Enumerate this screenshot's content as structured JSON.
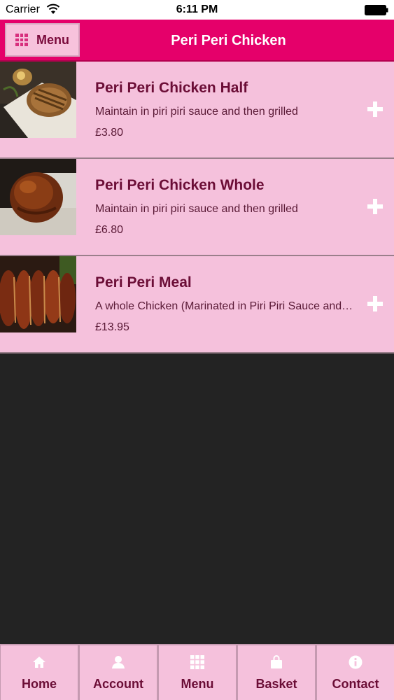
{
  "status_bar": {
    "carrier": "Carrier",
    "time": "6:11 PM"
  },
  "header": {
    "menu_button_label": "Menu",
    "title": "Peri Peri Chicken"
  },
  "items": [
    {
      "title": "Peri Peri Chicken Half",
      "description": "Maintain in piri piri sauce and then grilled",
      "price": "£3.80"
    },
    {
      "title": "Peri Peri Chicken Whole",
      "description": "Maintain in piri piri sauce and then grilled",
      "price": "£6.80"
    },
    {
      "title": "Peri Peri Meal",
      "description": "A whole Chicken (Marinated in Piri Piri Sauce and then grilled)",
      "price": "£13.95"
    }
  ],
  "tabs": [
    {
      "label": "Home",
      "icon": "home-icon"
    },
    {
      "label": "Account",
      "icon": "user-icon"
    },
    {
      "label": "Menu",
      "icon": "grid-icon"
    },
    {
      "label": "Basket",
      "icon": "bag-icon"
    },
    {
      "label": "Contact",
      "icon": "info-icon"
    }
  ],
  "colors": {
    "header_bg": "#e5006a",
    "item_bg": "#f5c1dc",
    "title_text": "#6b0d36",
    "page_bg": "#232323"
  }
}
